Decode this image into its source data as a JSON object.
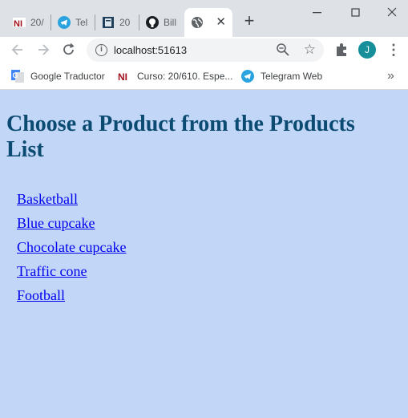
{
  "browser": {
    "tabs": [
      {
        "title": "20/",
        "icon": "ni-logo-icon",
        "active": false
      },
      {
        "title": "Tel",
        "icon": "telegram-icon",
        "active": false
      },
      {
        "title": "20",
        "icon": "book-icon",
        "active": false
      },
      {
        "title": "Bill",
        "icon": "github-icon",
        "active": false
      },
      {
        "title": "",
        "icon": "globe-icon",
        "active": true
      }
    ],
    "address": "localhost:51613",
    "avatar_initial": "J",
    "avatar_color": "#168f9a"
  },
  "bookmarks": [
    {
      "label": "Google Traductor",
      "icon": "google-translate-icon"
    },
    {
      "label": "Curso: 20/610. Espe...",
      "icon": "ni-logo-icon"
    },
    {
      "label": "Telegram Web",
      "icon": "telegram-icon"
    }
  ],
  "page": {
    "title": "Choose a Product from the Products List",
    "products": [
      "Basketball",
      "Blue cupcake",
      "Chocolate cupcake",
      "Traffic cone",
      "Football"
    ],
    "background": "#c2d7f7",
    "heading_color": "#0b4b72",
    "link_color": "#0000ee"
  }
}
